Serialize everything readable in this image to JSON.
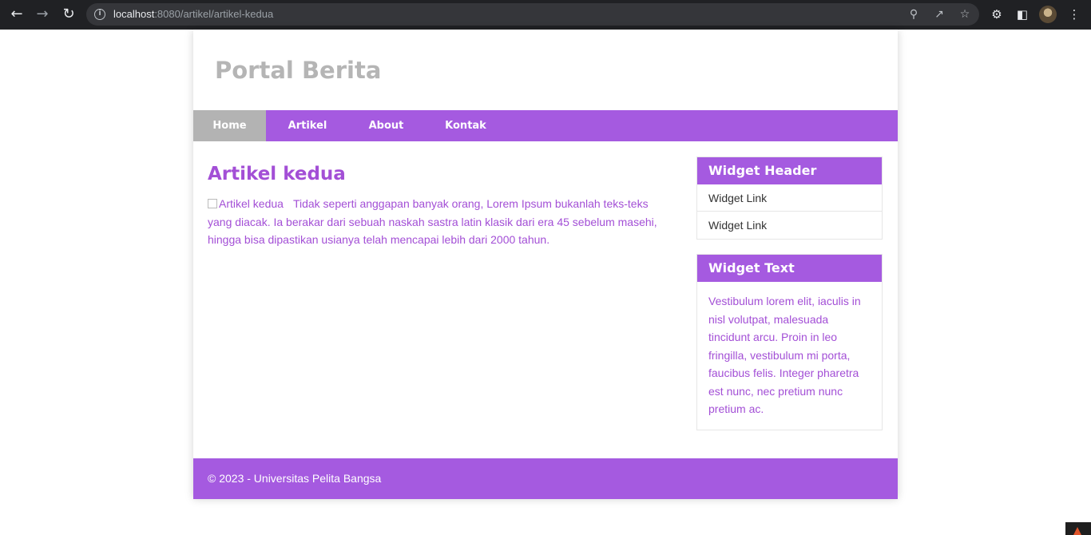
{
  "browser": {
    "url_host": "localhost",
    "url_path": ":8080/artikel/artikel-kedua"
  },
  "site": {
    "title": "Portal Berita"
  },
  "nav": {
    "items": [
      "Home",
      "Artikel",
      "About",
      "Kontak"
    ],
    "active": "Home"
  },
  "article": {
    "title": "Artikel kedua",
    "image_alt": "Artikel kedua",
    "body": "Tidak seperti anggapan banyak orang, Lorem Ipsum bukanlah teks-teks yang diacak. Ia berakar dari sebuah naskah sastra latin klasik dari era 45 sebelum masehi, hingga bisa dipastikan usianya telah mencapai lebih dari 2000 tahun."
  },
  "sidebar": {
    "widget_links": {
      "header": "Widget Header",
      "links": [
        "Widget Link",
        "Widget Link"
      ]
    },
    "widget_text": {
      "header": "Widget Text",
      "text": "Vestibulum lorem elit, iaculis in nisl volutpat, malesuada tincidunt arcu. Proin in leo fringilla, vestibulum mi porta, faucibus felis. Integer pharetra est nunc, nec pretium nunc pretium ac."
    }
  },
  "footer": {
    "text": "© 2023 - Universitas Pelita Bangsa"
  },
  "colors": {
    "accent": "#a55ae0",
    "text_purple": "#a34fd6",
    "nav_active": "#b3b3b3"
  }
}
